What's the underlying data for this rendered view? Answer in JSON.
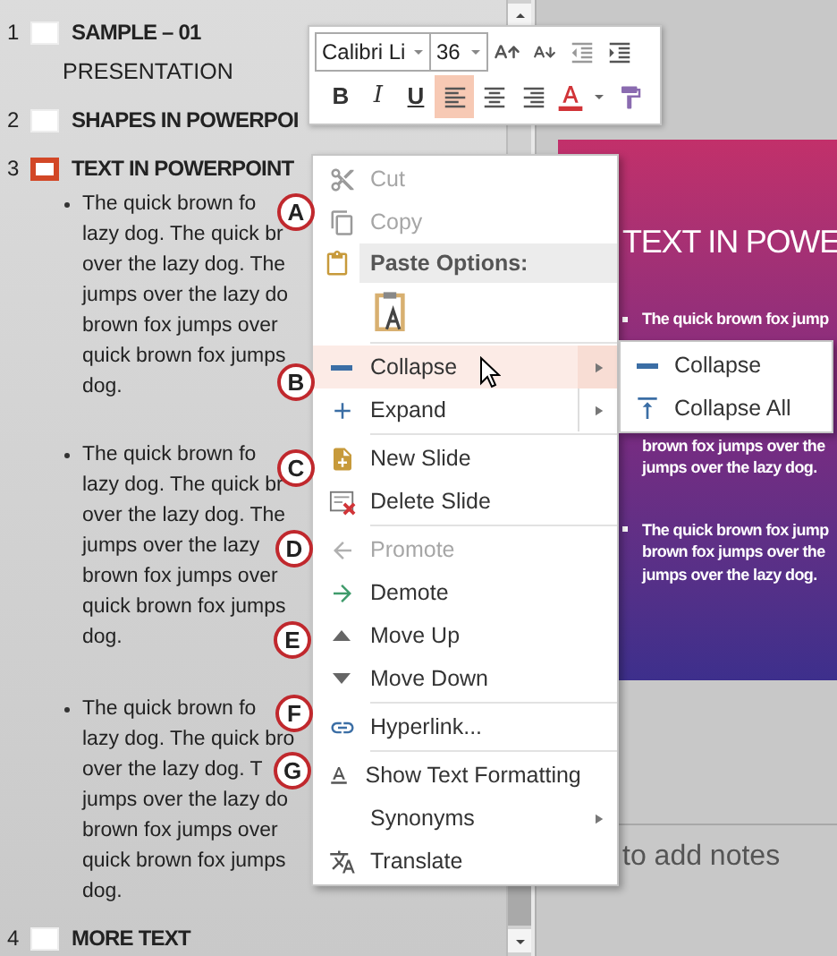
{
  "outline": {
    "slides": [
      {
        "number": "1",
        "title": "SAMPLE – 01",
        "subtitle": "PRESENTATION",
        "selected": false
      },
      {
        "number": "2",
        "title": "SHAPES IN POWERPOI",
        "selected": false
      },
      {
        "number": "3",
        "title": "TEXT IN POWERPOINT",
        "selected": true,
        "paragraphs": [
          {
            "bullet": true,
            "lines": [
              "The quick brown fo",
              "lazy dog. The quick br",
              "over the lazy dog. The",
              "jumps over the lazy do",
              "brown fox jumps over",
              "quick brown fox jumps",
              "dog."
            ]
          },
          {
            "bullet": true,
            "lines": [
              "The quick brown fo",
              "lazy dog. The quick br",
              "over the lazy dog. The",
              "jumps over the lazy",
              "brown fox jumps over",
              "quick brown fox jumps",
              "dog."
            ]
          },
          {
            "bullet": true,
            "lines": [
              "The quick brown fo",
              "lazy dog. The quick bro",
              "over the lazy dog. T",
              "jumps over the lazy do",
              "brown fox jumps over",
              "quick brown fox jumps",
              "dog."
            ]
          }
        ]
      },
      {
        "number": "4",
        "title": "MORE TEXT",
        "selected": false
      }
    ]
  },
  "slide": {
    "title": "TEXT IN POWE",
    "blocks": [
      {
        "bullet": true,
        "lines": [
          "The quick brown fox jump"
        ]
      },
      {
        "bullet": false,
        "lines": [
          "brown fox jumps over the",
          "jumps over the lazy dog."
        ]
      },
      {
        "bullet": true,
        "lines": [
          "The quick brown fox jump",
          "brown fox jumps over the",
          "jumps over the lazy dog."
        ]
      }
    ]
  },
  "notes": {
    "text": "to add notes"
  },
  "mini_toolbar": {
    "font": "Calibri Li",
    "size": "36",
    "styles": [
      "B",
      "I",
      "U"
    ],
    "align_buttons": [
      {
        "selected": true
      },
      {
        "selected": false
      },
      {
        "selected": false
      }
    ]
  },
  "context_menu": {
    "items": [
      {
        "kind": "item",
        "label": "Cut",
        "disabled": true,
        "highlighted": false,
        "submenu": false
      },
      {
        "kind": "item",
        "label": "Copy",
        "disabled": true,
        "highlighted": false,
        "submenu": false
      },
      {
        "kind": "header",
        "label": "Paste Options:"
      },
      {
        "kind": "paste"
      },
      {
        "kind": "separator"
      },
      {
        "kind": "item",
        "label": "Collapse",
        "disabled": false,
        "highlighted": true,
        "submenu": true,
        "split": true
      },
      {
        "kind": "item",
        "label": "Expand",
        "disabled": false,
        "highlighted": false,
        "submenu": true,
        "split": true
      },
      {
        "kind": "separator"
      },
      {
        "kind": "item",
        "label": "New Slide",
        "disabled": false,
        "highlighted": false,
        "submenu": false
      },
      {
        "kind": "item",
        "label": "Delete Slide",
        "disabled": false,
        "highlighted": false,
        "submenu": false
      },
      {
        "kind": "separator"
      },
      {
        "kind": "item",
        "label": "Promote",
        "disabled": true,
        "highlighted": false,
        "submenu": false
      },
      {
        "kind": "item",
        "label": "Demote",
        "disabled": false,
        "highlighted": false,
        "submenu": false
      },
      {
        "kind": "item",
        "label": "Move Up",
        "disabled": false,
        "highlighted": false,
        "submenu": false
      },
      {
        "kind": "item",
        "label": "Move Down",
        "disabled": false,
        "highlighted": false,
        "submenu": false
      },
      {
        "kind": "separator"
      },
      {
        "kind": "item",
        "label": "Hyperlink...",
        "disabled": false,
        "highlighted": false,
        "submenu": false
      },
      {
        "kind": "separator"
      },
      {
        "kind": "item",
        "label": "Show Text Formatting",
        "disabled": false,
        "highlighted": false,
        "submenu": false
      },
      {
        "kind": "item",
        "label": "Synonyms",
        "disabled": false,
        "highlighted": false,
        "submenu": true,
        "split": false
      },
      {
        "kind": "item",
        "label": "Translate",
        "disabled": false,
        "highlighted": false,
        "submenu": false
      }
    ]
  },
  "submenu": {
    "items": [
      {
        "label": "Collapse"
      },
      {
        "label": "Collapse All"
      }
    ]
  },
  "callouts": [
    {
      "label": "A"
    },
    {
      "label": "B"
    },
    {
      "label": "C"
    },
    {
      "label": "D"
    },
    {
      "label": "E"
    },
    {
      "label": "F"
    },
    {
      "label": "G"
    }
  ]
}
